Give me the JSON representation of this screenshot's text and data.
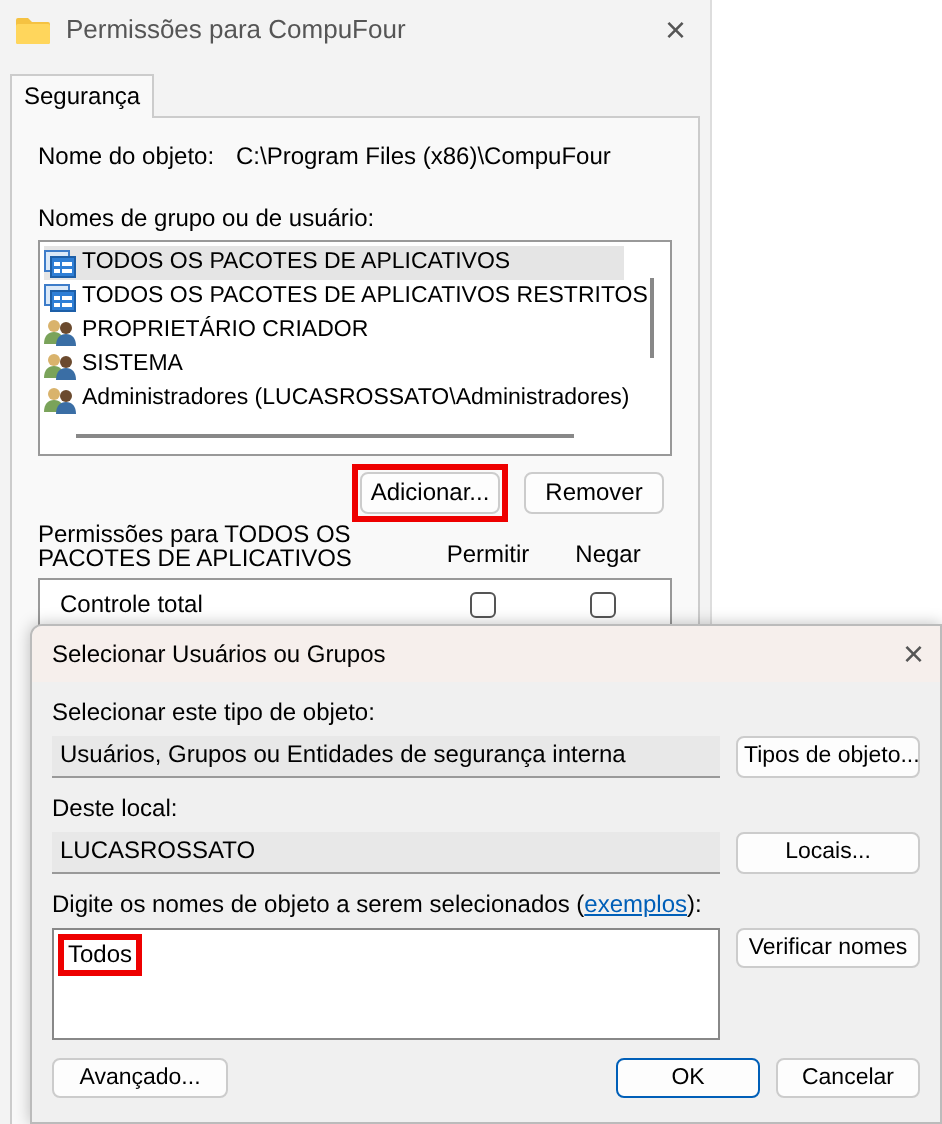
{
  "background_window": {
    "title": "Permissões para CompuFour",
    "close_button": "×",
    "tabs": [
      {
        "label": "Segurança",
        "selected": true
      }
    ],
    "object_name_label": "Nome do objeto:",
    "object_name": "C:\\Program Files (x86)\\CompuFour",
    "groups_label": "Nomes de grupo ou de usuário:",
    "groups": [
      {
        "name": "TODOS OS PACOTES DE APLICATIVOS",
        "kind": "package",
        "selected": true
      },
      {
        "name": "TODOS OS PACOTES DE APLICATIVOS RESTRITOS",
        "kind": "package",
        "selected": false
      },
      {
        "name": "PROPRIETÁRIO CRIADOR",
        "kind": "users",
        "selected": false
      },
      {
        "name": "SISTEMA",
        "kind": "users",
        "selected": false
      },
      {
        "name": "Administradores (LUCASROSSATO\\Administradores)",
        "kind": "users",
        "selected": false
      }
    ],
    "buttons": [
      {
        "label": "Adicionar...",
        "highlighted": true
      },
      {
        "label": "Remover",
        "highlighted": false
      }
    ],
    "permissions_label": "Permissões para TODOS OS PACOTES DE APLICATIVOS",
    "columns": [
      "Permitir",
      "Negar"
    ],
    "permissions": [
      {
        "name": "Controle total",
        "allow": false,
        "deny": false
      }
    ]
  },
  "dialog": {
    "title": "Selecionar Usuários ou Grupos",
    "close_button": "×",
    "object_type_label": "Selecionar este tipo de objeto:",
    "object_type": "Usuários, Grupos ou Entidades de segurança interna",
    "object_type_button": "Tipos de objeto...",
    "location_label": "Deste local:",
    "location": "LUCASROSSATO",
    "location_button": "Locais...",
    "names_label": {
      "before": "Digite os nomes de objeto a serem selecionados (",
      "link": "exemplos",
      "after": "):"
    },
    "names_value": "Todos",
    "names_highlighted": true,
    "check_button": "Verificar nomes",
    "advanced_button": "Avançado...",
    "ok_button": "OK",
    "cancel_button": "Cancelar"
  }
}
